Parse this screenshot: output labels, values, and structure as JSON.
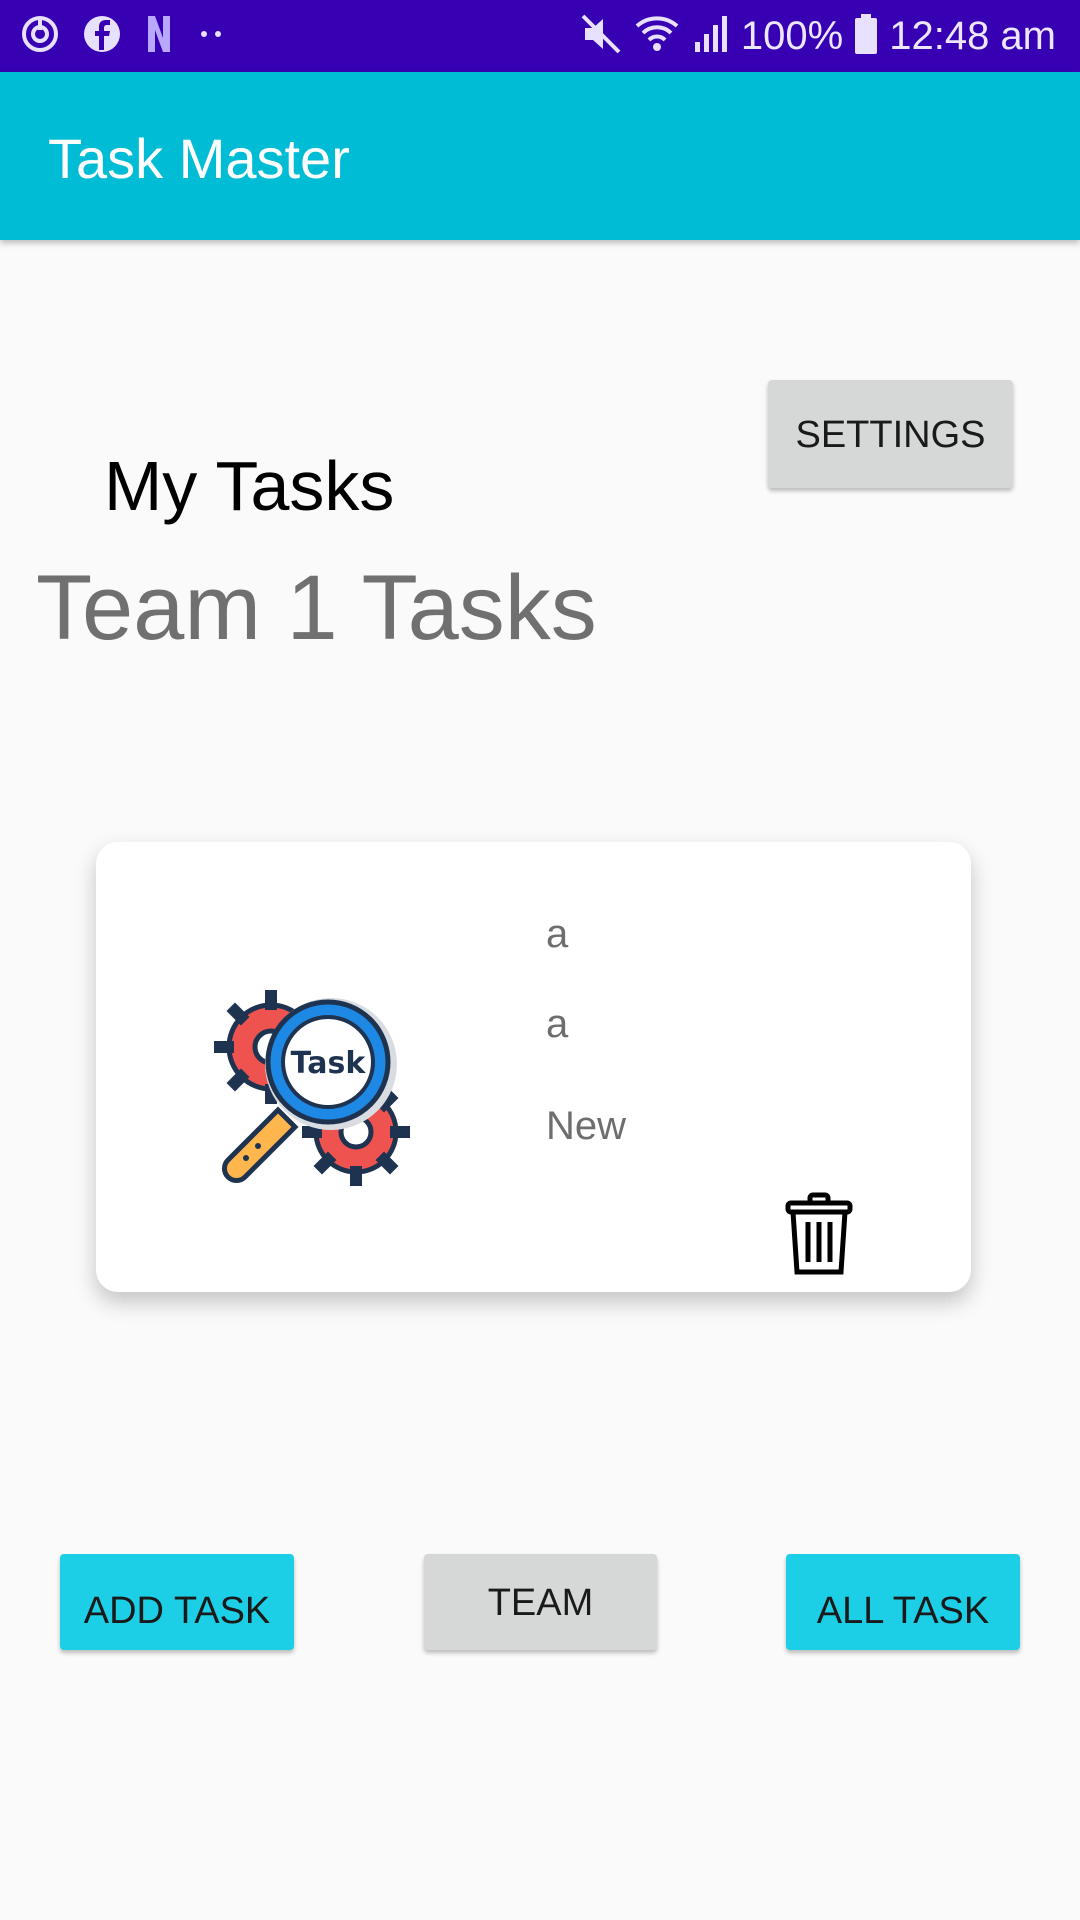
{
  "status_bar": {
    "battery": "100%",
    "time": "12:48 am",
    "icons": [
      "power-icon",
      "facebook-icon",
      "netflix-icon",
      "dots-icon",
      "mute-icon",
      "wifi-icon",
      "signal-icon",
      "battery-icon"
    ]
  },
  "app_bar": {
    "title": "Task Master"
  },
  "settings_button": {
    "label": "SETTINGS"
  },
  "my_tasks_title": "My Tasks",
  "team_tasks_title": "Team 1 Tasks",
  "task_card": {
    "logo_text": "Task",
    "title": "a",
    "body": "a",
    "state": "New"
  },
  "bottom_buttons": {
    "add_task": "ADD TASK",
    "team": "TEAM",
    "all_task": "ALL TASK"
  },
  "colors": {
    "status_bar": "#3700b3",
    "app_bar": "#00bcd4",
    "cyan_button": "#1ccfe6",
    "grey_button": "#d6d7d7"
  }
}
